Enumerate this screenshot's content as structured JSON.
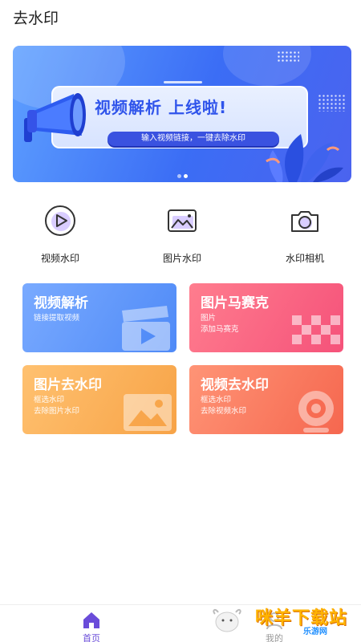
{
  "header": {
    "title": "去水印"
  },
  "banner": {
    "headline": "视频解析 上线啦!",
    "subtext": "输入视频链接，一键去除水印",
    "slide_count": 2,
    "active_slide": 2
  },
  "quick_actions": [
    {
      "label": "视频水印",
      "icon": "play-circle-icon"
    },
    {
      "label": "图片水印",
      "icon": "image-icon"
    },
    {
      "label": "水印相机",
      "icon": "camera-icon"
    }
  ],
  "tiles": [
    {
      "title": "视频解析",
      "lines": [
        "链接提取视频",
        ""
      ],
      "icon": "film-clapper-icon",
      "colors": [
        "#79aaff",
        "#4f8af7"
      ]
    },
    {
      "title": "图片马赛克",
      "lines": [
        "图片",
        "添加马赛克"
      ],
      "icon": "mosaic-icon",
      "colors": [
        "#ff7d8e",
        "#f5527a"
      ]
    },
    {
      "title": "图片去水印",
      "lines": [
        "框选水印",
        "去除图片水印"
      ],
      "icon": "picture-icon",
      "colors": [
        "#ffc170",
        "#f7a347"
      ]
    },
    {
      "title": "视频去水印",
      "lines": [
        "框选水印",
        "去除视频水印"
      ],
      "icon": "webcam-icon",
      "colors": [
        "#ff9476",
        "#f5674f"
      ]
    }
  ],
  "tabbar": {
    "items": [
      {
        "label": "首页",
        "icon": "home-icon",
        "active": true
      },
      {
        "label": "我的",
        "icon": "user-icon",
        "active": false
      }
    ],
    "active_color": "#6a4cd9"
  },
  "watermark": {
    "text": "咪羊下载站",
    "sub": "乐游网"
  },
  "colors": {
    "accent": "#6a4cd9",
    "banner_blue": "#3b6df5"
  }
}
